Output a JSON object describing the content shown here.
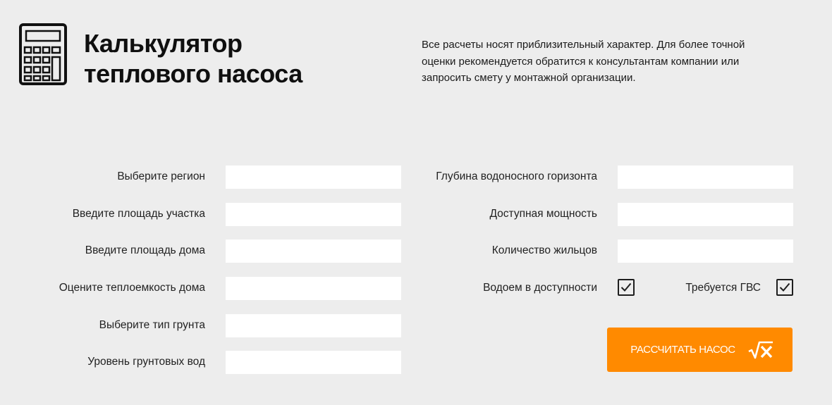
{
  "header": {
    "title_line1": "Калькулятор",
    "title_line2": "теплового насоса",
    "icon": "calculator-icon",
    "note": "Все расчеты носят приблизительный характер. Для более точной оценки рекомендуется обратится к консультантам компании или запросить смету у монтажной организации."
  },
  "form": {
    "left_fields": [
      {
        "label": "Выберите регион",
        "value": ""
      },
      {
        "label": "Введите площадь участка",
        "value": ""
      },
      {
        "label": "Введите площадь дома",
        "value": ""
      },
      {
        "label": "Оцените теплоемкость дома",
        "value": ""
      },
      {
        "label": "Выберите тип грунта",
        "value": ""
      },
      {
        "label": "Уровень грунтовых вод",
        "value": ""
      }
    ],
    "right_fields": [
      {
        "label": "Глубина водоносного горизонта",
        "value": ""
      },
      {
        "label": "Доступная мощность",
        "value": ""
      },
      {
        "label": "Количество жильцов",
        "value": ""
      }
    ],
    "checkboxes": [
      {
        "label": "Водоем в доступности",
        "checked": true
      },
      {
        "label": "Требуется ГВС",
        "checked": true
      }
    ],
    "submit": {
      "label": "РАССЧИТАТЬ НАСОС",
      "icon": "square-root-x-icon"
    }
  },
  "colors": {
    "background": "#ededed",
    "field_background": "#ffffff",
    "accent": "#ff8a00",
    "text": "#222222"
  }
}
